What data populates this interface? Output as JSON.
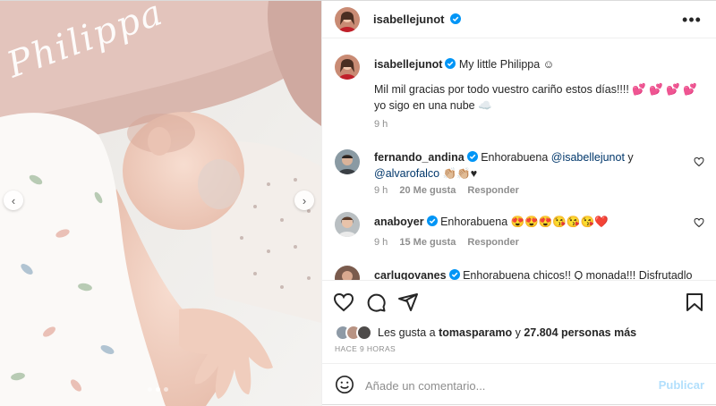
{
  "post": {
    "author": "isabellejunot",
    "watermark": "Philippa",
    "carousel": {
      "slide_count": 3,
      "active_slide": 2
    }
  },
  "header": {
    "username": "isabellejunot",
    "more_icon": "more-horizontal-icon"
  },
  "caption": {
    "username": "isabellejunot",
    "line1": "My little Philippa ☺",
    "line2": "Mil mil gracias por todo vuestro cariño estos días!!!! 💕 💕 💕 💕",
    "line3": "yo sigo en una nube ☁️",
    "time": "9 h"
  },
  "comments": [
    {
      "username": "fernando_andina",
      "text_before": "Enhorabuena ",
      "mention1": "@isabellejunot",
      "text_mid": " y",
      "mention2": "@alvarofalco",
      "text_after": " 👏🏼👏🏼♥",
      "time": "9 h",
      "likes": "20 Me gusta",
      "reply": "Responder"
    },
    {
      "username": "anaboyer",
      "text": "Enhorabuena 😍😍😍😘😘😘❤️",
      "time": "9 h",
      "likes": "15 Me gusta",
      "reply": "Responder"
    },
    {
      "username": "carlugovanes",
      "text": "Enhorabuena chicos!! Q monada!!! Disfrutadlo"
    }
  ],
  "likes": {
    "prefix": "Les gusta a",
    "user": "tomasparamo",
    "middle": "y",
    "count": "27.804 personas más"
  },
  "timestamp": "HACE 9 HORAS",
  "comment_box": {
    "placeholder": "Añade un comentario...",
    "publish_label": "Publicar"
  },
  "colors": {
    "accent": "#0095f6",
    "verified": "#0095f6",
    "publish_disabled": "#b2dffc",
    "muted": "#8e8e8e"
  }
}
